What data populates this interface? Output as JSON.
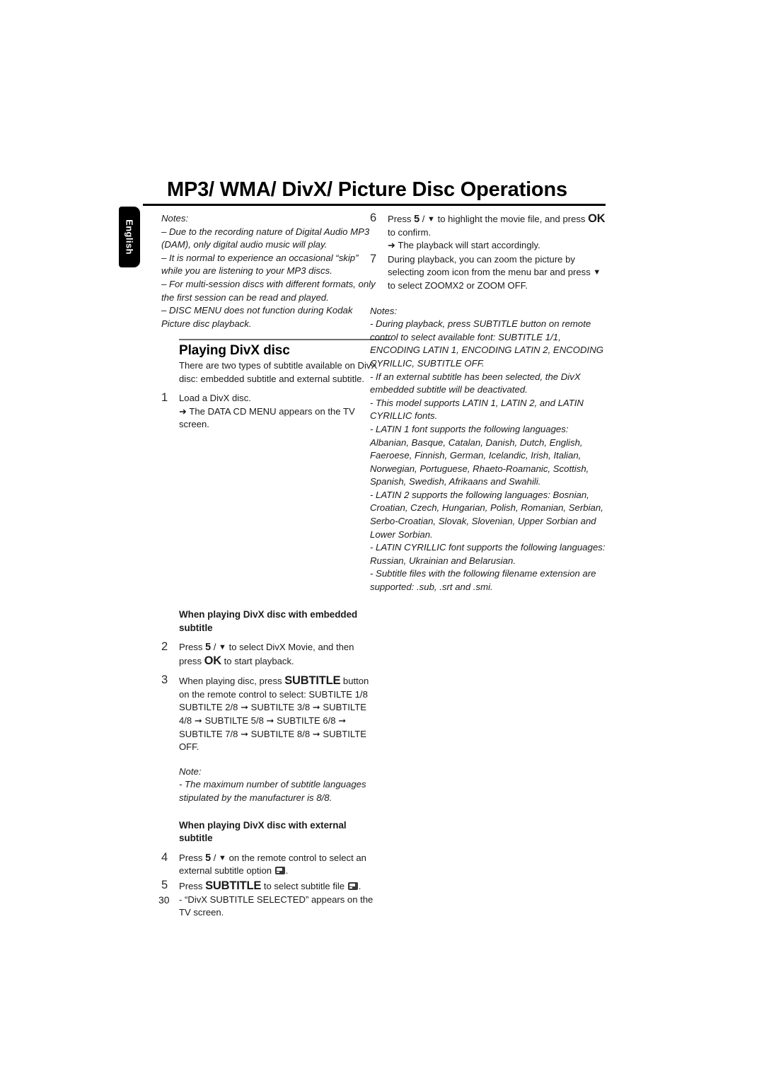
{
  "page": {
    "title": "MP3/ WMA/ DivX/ Picture Disc Operations",
    "language_tab": "English",
    "page_number": "30"
  },
  "left_column": {
    "notes_top": {
      "heading": "Notes:",
      "items": [
        "–  Due to the recording nature of Digital Audio MP3 (DAM), only digital audio music will play.",
        "–  It is normal to experience an occasional “skip” while you are listening to your MP3 discs.",
        "–  For multi-session discs with different formats, only the first session can be read and played.",
        "–  DISC MENU does not function during Kodak Picture disc playback."
      ]
    },
    "section_heading": "Playing DivX disc",
    "intro_paragraph": "There are two types of subtitle available on DivX disc: embedded subtitle and external subtitle.",
    "step1": {
      "number": "1",
      "text": "Load a DivX disc.",
      "arrow_text": "The DATA CD MENU appears on the TV screen."
    },
    "subheading_embedded": "When playing DivX disc with embedded subtitle",
    "step2": {
      "number": "2",
      "part1": "Press ",
      "key_up": "5",
      "slash": " / ",
      "key_down": "▼",
      "part2": " to select DivX Movie, and then press ",
      "key_ok": "OK",
      "part3": " to start playback."
    },
    "step3": {
      "number": "3",
      "part1": "When playing disc, press ",
      "key_subtitle": "SUBTITLE",
      "part2": " button on the remote control to select: SUBTILTE 1/8 ",
      "chain": "SUBTILTE 2/8 ➞ SUBTILTE 3/8 ➞ SUBTILTE 4/8 ➞ SUBTILTE 5/8 ➞ SUBTILTE 6/8 ➞ SUBTILTE 7/8 ➞ SUBTILTE 8/8 ➞ SUBTILTE OFF."
    },
    "note_mid": {
      "heading": "Note:",
      "text": "- The maximum number of subtitle languages stipulated by the manufacturer is 8/8."
    },
    "subheading_external": "When playing DivX disc with external subtitle",
    "step4": {
      "number": "4",
      "part1": "Press ",
      "key_up": "5",
      "slash": " / ",
      "key_down": "▼",
      "part2": " on the remote control to select an external subtitle option ",
      "icon": "subtitle-icon",
      "part3": "."
    },
    "step5": {
      "number": "5",
      "part1": "Press ",
      "key_subtitle": "SUBTITLE",
      "part2": " to select subtitle file ",
      "icon": "subtitle-icon",
      "part3": ".",
      "dash_text": "- “DivX SUBTITLE SELECTED” appears on the TV screen."
    }
  },
  "right_column": {
    "step6": {
      "number": "6",
      "part1": "Press ",
      "key_up": "5",
      "slash": " / ",
      "key_down": "▼",
      "part2": " to highlight the movie file, and press ",
      "key_ok": "OK",
      "part3": " to confirm.",
      "arrow_text": "The playback will start accordingly."
    },
    "step7": {
      "number": "7",
      "part1": "During playback, you can zoom the picture by selecting zoom icon from the menu bar and press ",
      "key_down": "▼",
      "part2": " to select ZOOMX2 or ZOOM OFF."
    },
    "notes": {
      "heading": "Notes:",
      "items": [
        "- During playback, press SUBTITLE button on remote control to select available font: SUBTITLE 1/1, ENCODING LATIN 1, ENCODING LATIN 2, ENCODING CYRILLIC, SUBTITLE OFF.",
        "- If an external subtitle has been selected, the DivX embedded subtitle will be deactivated.",
        "- This model supports LATIN 1, LATIN 2, and LATIN CYRILLIC fonts.",
        "- LATIN 1 font supports the following languages: Albanian, Basque, Catalan, Danish, Dutch, English, Faeroese, Finnish, German, Icelandic, Irish, Italian, Norwegian, Portuguese, Rhaeto-Roamanic, Scottish, Spanish, Swedish, Afrikaans and Swahili.",
        "- LATIN 2 supports the following languages: Bosnian, Croatian, Czech, Hungarian, Polish, Romanian, Serbian, Serbo-Croatian, Slovak, Slovenian, Upper Sorbian and Lower Sorbian.",
        "- LATIN CYRILLIC font supports the following languages: Russian, Ukrainian and Belarusian.",
        "- Subtitle files with the following filename extension are supported: .sub, .srt and .smi."
      ]
    }
  },
  "colors": {
    "text": "#1a1a1a",
    "rule_dark": "#000000",
    "rule_gray": "#6e6e6e",
    "tab_bg": "#000000",
    "tab_text": "#ffffff"
  }
}
